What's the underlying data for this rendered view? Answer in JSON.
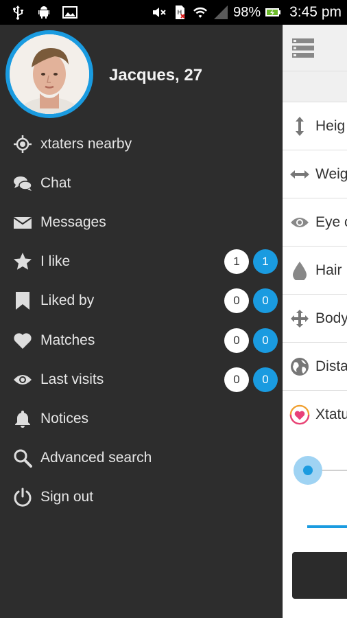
{
  "status_bar": {
    "battery_percent": "98%",
    "time": "3:45 pm",
    "icons": [
      "usb-icon",
      "android-icon",
      "image-icon",
      "mute-icon",
      "sim-alert-icon",
      "wifi-icon",
      "signal-icon",
      "battery-charging-icon"
    ]
  },
  "profile": {
    "name": "Jacques, 27",
    "ring_color": "#1a9be0"
  },
  "menu": {
    "items": [
      {
        "label": "xtaters nearby",
        "icon": "location-target-icon"
      },
      {
        "label": "Chat",
        "icon": "chat-bubbles-icon"
      },
      {
        "label": "Messages",
        "icon": "envelope-icon"
      },
      {
        "label": "I like",
        "icon": "star-icon",
        "badge_white": "1",
        "badge_blue": "1"
      },
      {
        "label": "Liked by",
        "icon": "bookmark-icon",
        "badge_white": "0",
        "badge_blue": "0"
      },
      {
        "label": "Matches",
        "icon": "heart-icon",
        "badge_white": "0",
        "badge_blue": "0"
      },
      {
        "label": "Last visits",
        "icon": "eye-icon",
        "badge_white": "0",
        "badge_blue": "0"
      },
      {
        "label": "Notices",
        "icon": "bell-icon"
      },
      {
        "label": "Advanced search",
        "icon": "search-icon"
      },
      {
        "label": "Sign out",
        "icon": "power-icon"
      }
    ]
  },
  "content": {
    "attributes": [
      {
        "label": "Heig",
        "icon": "vertical-arrows-icon"
      },
      {
        "label": "Weig",
        "icon": "horizontal-arrows-icon"
      },
      {
        "label": "Eye c",
        "icon": "eye-icon"
      },
      {
        "label": "Hair",
        "icon": "drop-icon"
      },
      {
        "label": "Body",
        "icon": "move-arrows-icon"
      },
      {
        "label": "Dista",
        "icon": "globe-icon"
      },
      {
        "label": "Xtatu",
        "icon": "heart-badge-icon"
      }
    ]
  },
  "colors": {
    "accent": "#1a9be0",
    "drawer_bg": "#2d2d2d",
    "menu_text": "#e6e6e6"
  }
}
